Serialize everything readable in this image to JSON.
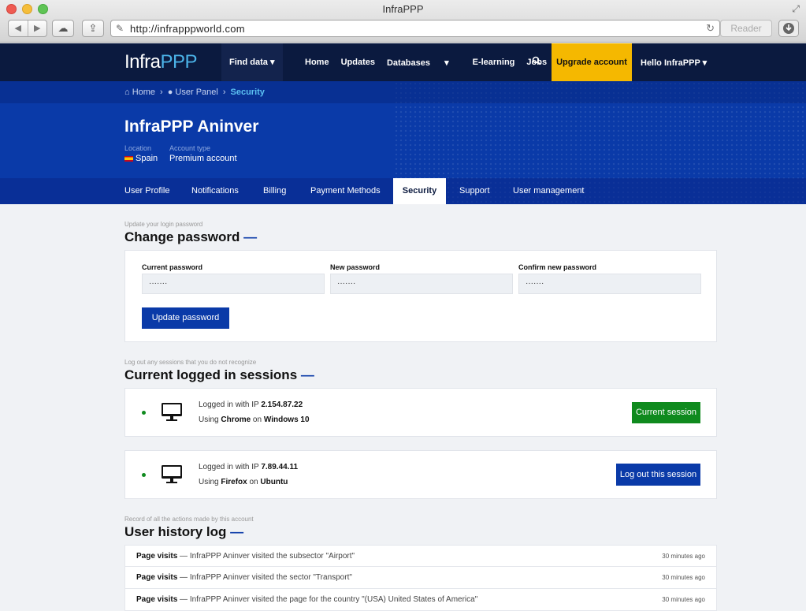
{
  "browser": {
    "window_title": "InfraPPP",
    "url": "http://infrapppworld.com",
    "reader_label": "Reader"
  },
  "nav": {
    "logo_main": "Infra",
    "logo_accent": "PPP",
    "find_data": "Find data",
    "links": [
      "Home",
      "Updates",
      "Databases",
      "E-learning",
      "Jobs"
    ],
    "upgrade": "Upgrade account",
    "hello": "Hello InfraPPP"
  },
  "breadcrumb": {
    "home": "Home",
    "user_panel": "User Panel",
    "current": "Security"
  },
  "profile": {
    "name": "InfraPPP Aninver",
    "location_label": "Location",
    "location_value": "Spain",
    "account_type_label": "Account type",
    "account_type_value": "Premium account"
  },
  "tabs": [
    "User Profile",
    "Notifications",
    "Billing",
    "Payment Methods",
    "Security",
    "Support",
    "User management"
  ],
  "active_tab": "Security",
  "password": {
    "hint": "Update your login password",
    "title": "Change password",
    "current_label": "Current password",
    "current_value": "·······",
    "new_label": "New password",
    "new_value": "·······",
    "confirm_label": "Confirm new password",
    "confirm_value": "·······",
    "button": "Update password"
  },
  "sessions": {
    "hint": "Log out any sessions that you do not recognize",
    "title": "Current logged in sessions",
    "items": [
      {
        "ip_prefix": "Logged in with IP ",
        "ip": "2.154.87.22",
        "using": "Using ",
        "browser": "Chrome",
        "on": " on ",
        "os": "Windows 10",
        "action": "Current session"
      },
      {
        "ip_prefix": "Logged in with IP ",
        "ip": "7.89.44.11",
        "using": "Using ",
        "browser": "Firefox",
        "on": " on ",
        "os": "Ubuntu",
        "action": "Log out this session"
      }
    ]
  },
  "history": {
    "hint": "Record of all the actions made by this account",
    "title": "User history log",
    "rows": [
      {
        "type": "Page visits",
        "text": " — InfraPPP Aninver visited the subsector \"Airport\"",
        "time": "30 minutes ago"
      },
      {
        "type": "Page visits",
        "text": " — InfraPPP Aninver visited the sector \"Transport\"",
        "time": "30 minutes ago"
      },
      {
        "type": "Page visits",
        "text": " — InfraPPP Aninver visited the page for the country \"(USA) United States of America\"",
        "time": "30 minutes ago"
      }
    ]
  },
  "colors": {
    "nav_bg": "#0b1a3f",
    "hero_bg": "#0a3aa8",
    "accent_yellow": "#f5b800",
    "accent_green": "#0f8a1e",
    "link_blue": "#5cc1f2"
  }
}
